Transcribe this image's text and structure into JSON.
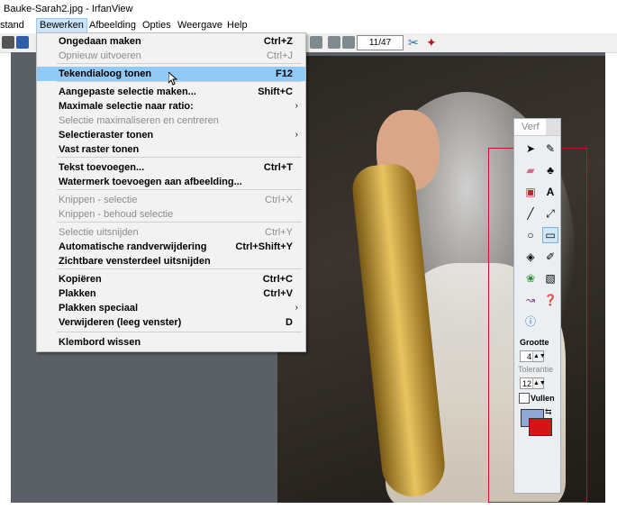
{
  "window": {
    "title": "Bauke-Sarah2.jpg - IrfanView"
  },
  "menubar": [
    "stand",
    "Bewerken",
    "Afbeelding",
    "Opties",
    "Weergave",
    "Help"
  ],
  "toolbar": {
    "counter": "11/47"
  },
  "menu": {
    "items": [
      {
        "label": "Ongedaan maken",
        "shortcut": "Ctrl+Z",
        "enabled": true
      },
      {
        "label": "Opnieuw uitvoeren",
        "shortcut": "Ctrl+J",
        "enabled": false
      },
      {
        "label": "Tekendialoog tonen",
        "shortcut": "F12",
        "enabled": true,
        "highlighted": true
      },
      {
        "label": "Aangepaste selectie maken...",
        "shortcut": "Shift+C",
        "enabled": true
      },
      {
        "label": "Maximale selectie naar ratio:",
        "shortcut": "›",
        "enabled": true
      },
      {
        "label": "Selectie maximaliseren en centreren",
        "shortcut": "",
        "enabled": false
      },
      {
        "label": "Selectieraster tonen",
        "shortcut": "›",
        "enabled": true
      },
      {
        "label": "Vast raster tonen",
        "shortcut": "",
        "enabled": true
      },
      {
        "label": "Tekst toevoegen...",
        "shortcut": "Ctrl+T",
        "enabled": true
      },
      {
        "label": "Watermerk toevoegen aan afbeelding...",
        "shortcut": "",
        "enabled": true
      },
      {
        "label": "Knippen - selectie",
        "shortcut": "Ctrl+X",
        "enabled": false
      },
      {
        "label": "Knippen - behoud selectie",
        "shortcut": "",
        "enabled": false
      },
      {
        "label": "Selectie uitsnijden",
        "shortcut": "Ctrl+Y",
        "enabled": false
      },
      {
        "label": "Automatische randverwijdering",
        "shortcut": "Ctrl+Shift+Y",
        "enabled": true
      },
      {
        "label": "Zichtbare vensterdeel uitsnijden",
        "shortcut": "",
        "enabled": true
      },
      {
        "label": "Kopiëren",
        "shortcut": "Ctrl+C",
        "enabled": true
      },
      {
        "label": "Plakken",
        "shortcut": "Ctrl+V",
        "enabled": true
      },
      {
        "label": "Plakken speciaal",
        "shortcut": "›",
        "enabled": true
      },
      {
        "label": "Verwijderen (leeg venster)",
        "shortcut": "D",
        "enabled": true
      },
      {
        "label": "Klembord wissen",
        "shortcut": "",
        "enabled": true
      }
    ]
  },
  "paint": {
    "title": "Verf",
    "tools": [
      "select-arrow",
      "pen",
      "eraser",
      "clone-stamp",
      "color-picker",
      "text",
      "line",
      "arrow-line",
      "ellipse",
      "rectangle",
      "fill-bucket",
      "brush",
      "red-eye",
      "spray",
      "curve",
      "help",
      "info"
    ],
    "grootte_label": "Grootte",
    "grootte_value": "4",
    "tolerantie_label": "Tolerantie",
    "tolerantie_value": "12",
    "vullen_label": "Vullen",
    "foreground_color": "#8fa8d6",
    "background_color": "#d41515"
  }
}
